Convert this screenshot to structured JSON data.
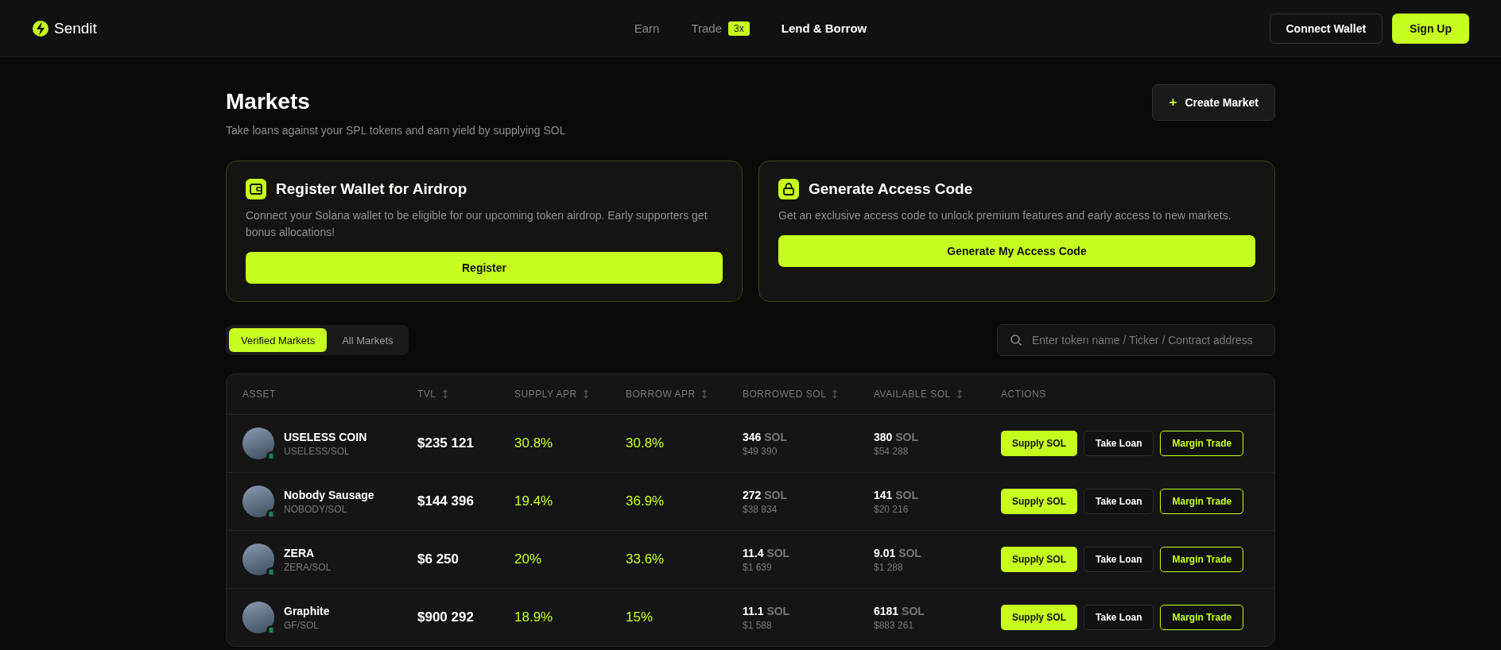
{
  "header": {
    "logo": "Sendit",
    "nav": [
      {
        "label": "Earn",
        "selected": false
      },
      {
        "label": "Trade",
        "badge": "3x",
        "selected": false
      },
      {
        "label": "Lend & Borrow",
        "selected": true
      }
    ],
    "buttons": [
      {
        "label": "Connect Wallet",
        "kind": "outline"
      },
      {
        "label": "Sign Up",
        "kind": "primary"
      }
    ]
  },
  "page": {
    "title": "Markets",
    "subtitle": "Take loans against your SPL tokens and earn yield by supplying SOL",
    "create_icon": "+",
    "create_button": "Create Market"
  },
  "promo_cards": [
    {
      "title": "Register Wallet for Airdrop",
      "text": "Connect your Solana wallet to be eligible for our upcoming token airdrop. Early supporters get bonus allocations!",
      "button": "Register"
    },
    {
      "title": "Generate Access Code",
      "text": "Get an exclusive access code to unlock premium features and early access to new markets.",
      "button": "Generate My Access Code"
    }
  ],
  "market_tabs": [
    {
      "label": "Verified Markets",
      "selected": true
    },
    {
      "label": "All Markets",
      "selected": false
    }
  ],
  "search": {
    "placeholder": "Enter token name / Ticker / Contract address"
  },
  "table": {
    "columns": [
      {
        "label": "ASSET",
        "sortable": false
      },
      {
        "label": "TVL",
        "sortable": true
      },
      {
        "label": "SUPPLY APR",
        "sortable": true
      },
      {
        "label": "BORROW APR",
        "sortable": true
      },
      {
        "label": "BORROWED SOL",
        "sortable": true
      },
      {
        "label": "AVAILABLE SOL",
        "sortable": true
      },
      {
        "label": "ACTIONS",
        "sortable": false
      }
    ],
    "rows": [
      {
        "name": "USELESS COIN",
        "pair": "USELESS/SOL",
        "tvl": "$235 121",
        "supply_apr": "30.8%",
        "borrow_apr": "30.8%",
        "borrowed": "346",
        "borrowed_unit": "SOL",
        "borrowed_usd": "$49 390",
        "available": "380",
        "available_unit": "SOL",
        "available_usd": "$54 288",
        "actions": [
          "Supply SOL",
          "Take Loan",
          "Margin Trade"
        ]
      },
      {
        "name": "Nobody Sausage",
        "pair": "NOBODY/SOL",
        "tvl": "$144 396",
        "supply_apr": "19.4%",
        "borrow_apr": "36.9%",
        "borrowed": "272",
        "borrowed_unit": "SOL",
        "borrowed_usd": "$38 834",
        "available": "141",
        "available_unit": "SOL",
        "available_usd": "$20 216",
        "actions": [
          "Supply SOL",
          "Take Loan",
          "Margin Trade"
        ]
      },
      {
        "name": "ZERA",
        "pair": "ZERA/SOL",
        "tvl": "$6 250",
        "supply_apr": "20%",
        "borrow_apr": "33.6%",
        "borrowed": "11.4",
        "borrowed_unit": "SOL",
        "borrowed_usd": "$1 639",
        "available": "9.01",
        "available_unit": "SOL",
        "available_usd": "$1 288",
        "actions": [
          "Supply SOL",
          "Take Loan",
          "Margin Trade"
        ]
      },
      {
        "name": "Graphite",
        "pair": "GF/SOL",
        "tvl": "$900 292",
        "supply_apr": "18.9%",
        "borrow_apr": "15%",
        "borrowed": "11.1",
        "borrowed_unit": "SOL",
        "borrowed_usd": "$1 588",
        "available": "6181",
        "available_unit": "SOL",
        "available_usd": "$883 261",
        "actions": [
          "Supply SOL",
          "Take Loan",
          "Margin Trade"
        ]
      }
    ]
  }
}
